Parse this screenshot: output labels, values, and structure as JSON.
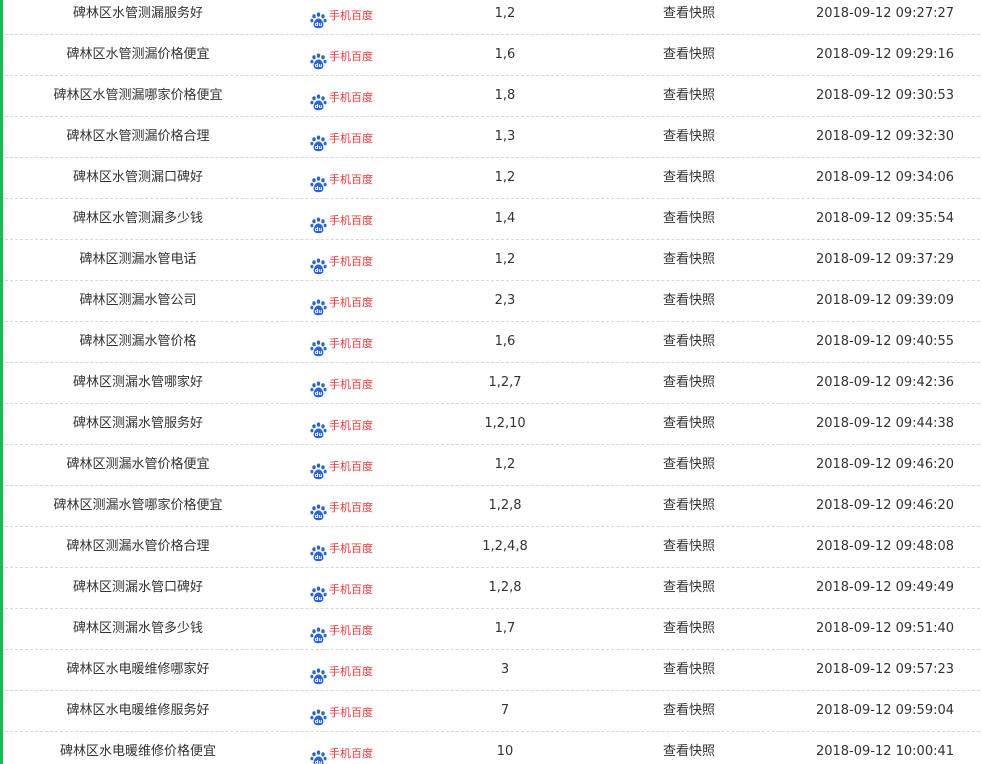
{
  "colors": {
    "accent_bar": "#19b955",
    "engine_label": "#e4393c",
    "engine_icon": "#2a62d8",
    "row_divider": "#d6d6d6",
    "text": "#333333"
  },
  "engine_icon_name": "baidu-paw-icon",
  "rows": [
    {
      "keyword": "碑林区水管测漏服务好",
      "engine": "手机百度",
      "rank": "1,2",
      "snapshot": "查看快照",
      "time": "2018-09-12 09:27:27"
    },
    {
      "keyword": "碑林区水管测漏价格便宜",
      "engine": "手机百度",
      "rank": "1,6",
      "snapshot": "查看快照",
      "time": "2018-09-12 09:29:16"
    },
    {
      "keyword": "碑林区水管测漏哪家价格便宜",
      "engine": "手机百度",
      "rank": "1,8",
      "snapshot": "查看快照",
      "time": "2018-09-12 09:30:53"
    },
    {
      "keyword": "碑林区水管测漏价格合理",
      "engine": "手机百度",
      "rank": "1,3",
      "snapshot": "查看快照",
      "time": "2018-09-12 09:32:30"
    },
    {
      "keyword": "碑林区水管测漏口碑好",
      "engine": "手机百度",
      "rank": "1,2",
      "snapshot": "查看快照",
      "time": "2018-09-12 09:34:06"
    },
    {
      "keyword": "碑林区水管测漏多少钱",
      "engine": "手机百度",
      "rank": "1,4",
      "snapshot": "查看快照",
      "time": "2018-09-12 09:35:54"
    },
    {
      "keyword": "碑林区测漏水管电话",
      "engine": "手机百度",
      "rank": "1,2",
      "snapshot": "查看快照",
      "time": "2018-09-12 09:37:29"
    },
    {
      "keyword": "碑林区测漏水管公司",
      "engine": "手机百度",
      "rank": "2,3",
      "snapshot": "查看快照",
      "time": "2018-09-12 09:39:09"
    },
    {
      "keyword": "碑林区测漏水管价格",
      "engine": "手机百度",
      "rank": "1,6",
      "snapshot": "查看快照",
      "time": "2018-09-12 09:40:55"
    },
    {
      "keyword": "碑林区测漏水管哪家好",
      "engine": "手机百度",
      "rank": "1,2,7",
      "snapshot": "查看快照",
      "time": "2018-09-12 09:42:36"
    },
    {
      "keyword": "碑林区测漏水管服务好",
      "engine": "手机百度",
      "rank": "1,2,10",
      "snapshot": "查看快照",
      "time": "2018-09-12 09:44:38"
    },
    {
      "keyword": "碑林区测漏水管价格便宜",
      "engine": "手机百度",
      "rank": "1,2",
      "snapshot": "查看快照",
      "time": "2018-09-12 09:46:20"
    },
    {
      "keyword": "碑林区测漏水管哪家价格便宜",
      "engine": "手机百度",
      "rank": "1,2,8",
      "snapshot": "查看快照",
      "time": "2018-09-12 09:46:20"
    },
    {
      "keyword": "碑林区测漏水管价格合理",
      "engine": "手机百度",
      "rank": "1,2,4,8",
      "snapshot": "查看快照",
      "time": "2018-09-12 09:48:08"
    },
    {
      "keyword": "碑林区测漏水管口碑好",
      "engine": "手机百度",
      "rank": "1,2,8",
      "snapshot": "查看快照",
      "time": "2018-09-12 09:49:49"
    },
    {
      "keyword": "碑林区测漏水管多少钱",
      "engine": "手机百度",
      "rank": "1,7",
      "snapshot": "查看快照",
      "time": "2018-09-12 09:51:40"
    },
    {
      "keyword": "碑林区水电暖维修哪家好",
      "engine": "手机百度",
      "rank": "3",
      "snapshot": "查看快照",
      "time": "2018-09-12 09:57:23"
    },
    {
      "keyword": "碑林区水电暖维修服务好",
      "engine": "手机百度",
      "rank": "7",
      "snapshot": "查看快照",
      "time": "2018-09-12 09:59:04"
    },
    {
      "keyword": "碑林区水电暖维修价格便宜",
      "engine": "手机百度",
      "rank": "10",
      "snapshot": "查看快照",
      "time": "2018-09-12 10:00:41"
    }
  ]
}
